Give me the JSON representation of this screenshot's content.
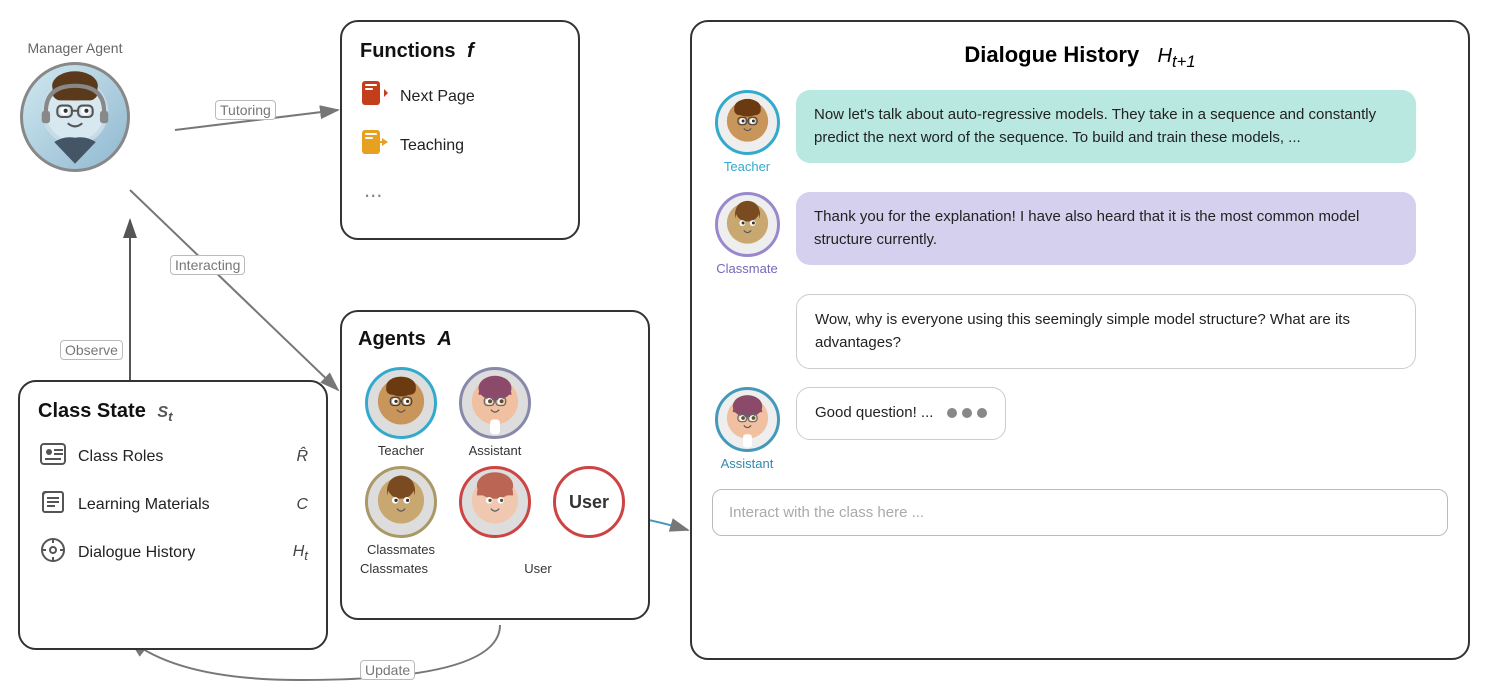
{
  "manager": {
    "label": "Manager Agent"
  },
  "arrows": {
    "tutoring": "Tutoring",
    "interacting": "Interacting",
    "observe": "Observe",
    "update": "Update"
  },
  "functions": {
    "title": "Functions",
    "title_math": "f",
    "items": [
      {
        "icon": "📊",
        "label": "Next Page"
      },
      {
        "icon": "📤",
        "label": "Teaching"
      },
      {
        "icon": "",
        "label": "..."
      }
    ]
  },
  "class_state": {
    "title": "Class State",
    "title_math": "S_t",
    "items": [
      {
        "icon": "🪪",
        "label": "Class Roles",
        "math": "R̂"
      },
      {
        "icon": "📖",
        "label": "Learning Materials",
        "math": "C"
      },
      {
        "icon": "🔍",
        "label": "Dialogue History",
        "math": "H_t"
      }
    ]
  },
  "agents": {
    "title": "Agents",
    "title_math": "A",
    "list": [
      {
        "name": "Teacher",
        "border": "teacher"
      },
      {
        "name": "Assistant",
        "border": "assistant"
      },
      {
        "name": "Classmates",
        "border": "classmate"
      },
      {
        "name": "User",
        "border": "user",
        "is_user": true
      }
    ]
  },
  "dialogue": {
    "title": "Dialogue History",
    "title_math": "H_{t+1}",
    "messages": [
      {
        "speaker": "Teacher",
        "bubble_type": "teal",
        "text": "Now let's talk about auto-regressive models. They take in a sequence and constantly predict the next word of the sequence. To build and train these models, ..."
      },
      {
        "speaker": "Classmate",
        "bubble_type": "purple",
        "text": "Thank you for the explanation! I have also heard that it is the most common model structure currently."
      },
      {
        "speaker": null,
        "bubble_type": "white",
        "text": "Wow, why is everyone using this seemingly simple model structure? What are its advantages?"
      },
      {
        "speaker": "Assistant",
        "bubble_type": "typing",
        "text": "Good question! ..."
      }
    ],
    "input_placeholder": "Interact with the class here ..."
  }
}
